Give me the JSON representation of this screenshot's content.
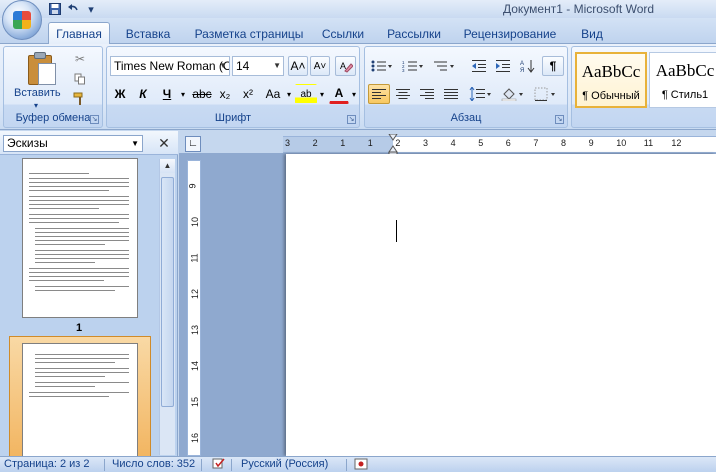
{
  "window": {
    "title": "Документ1 - Microsoft Word"
  },
  "qat": {
    "save_icon": "save-icon",
    "undo_icon": "undo-icon",
    "more_icon": "customize-icon"
  },
  "tabs": [
    {
      "label": "Главная",
      "active": true
    },
    {
      "label": "Вставка"
    },
    {
      "label": "Разметка страницы"
    },
    {
      "label": "Ссылки"
    },
    {
      "label": "Рассылки"
    },
    {
      "label": "Рецензирование"
    },
    {
      "label": "Вид"
    }
  ],
  "ribbon": {
    "clipboard": {
      "label": "Буфер обмена",
      "paste_label": "Вставить"
    },
    "font": {
      "label": "Шрифт",
      "font_name": "Times New Roman (С",
      "font_size": "14",
      "grow": "A˄",
      "shrink": "A˅",
      "bold": "Ж",
      "italic": "К",
      "underline": "Ч",
      "strike": "abc",
      "subscript": "x₂",
      "superscript": "x²",
      "case": "Aa",
      "highlight": "ab",
      "font_color": "A"
    },
    "paragraph": {
      "label": "Абзац",
      "pilcrow": "¶"
    },
    "styles": [
      {
        "sample": "AaBbCc",
        "name": "¶ Обычный",
        "selected": true
      },
      {
        "sample": "AaBbCc",
        "name": "¶ Стиль1"
      }
    ]
  },
  "pane": {
    "view_label": "Эскизы",
    "page1_number": "1"
  },
  "ruler": {
    "h_ticks": [
      "3",
      "2",
      "1",
      "1",
      "2",
      "3",
      "4",
      "5",
      "6",
      "7",
      "8",
      "9",
      "10",
      "11",
      "12"
    ],
    "v_ticks": [
      "9",
      "10",
      "11",
      "12",
      "13",
      "14",
      "15",
      "16"
    ]
  },
  "status": {
    "page": "Страница: 2 из 2",
    "words": "Число слов: 352",
    "language": "Русский (Россия)"
  }
}
